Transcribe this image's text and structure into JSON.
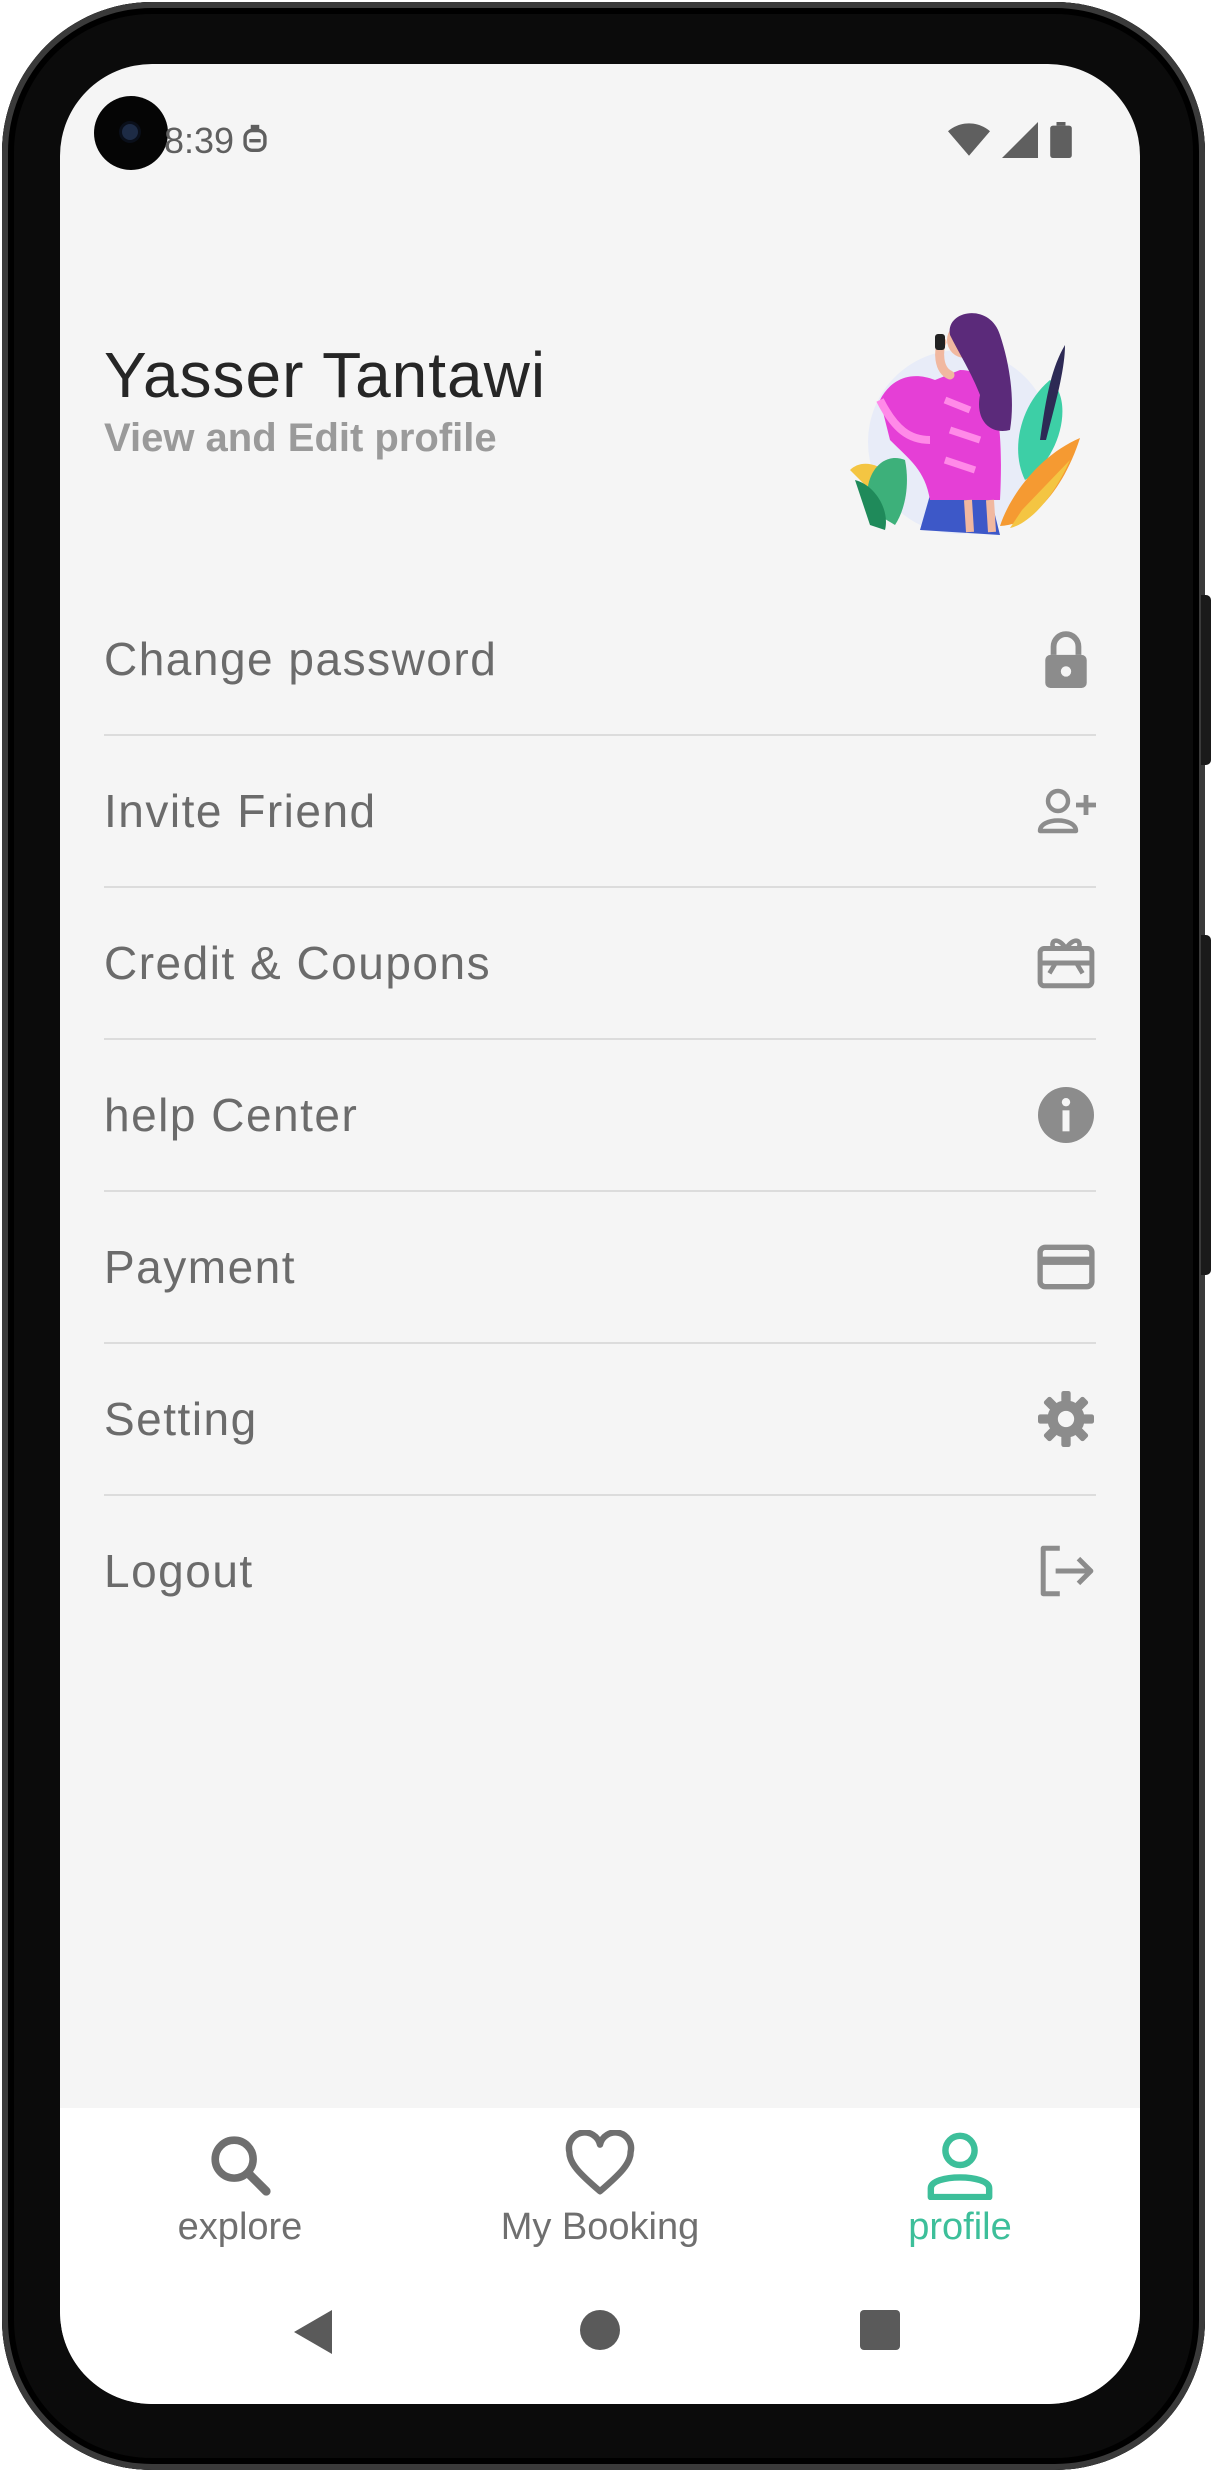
{
  "status_bar": {
    "time": "8:39",
    "icons": [
      "notification-icon",
      "wifi-icon",
      "signal-icon",
      "battery-icon"
    ]
  },
  "profile": {
    "name": "Yasser Tantawi",
    "subtitle": "View and Edit profile",
    "avatar_icon": "avatar-illustration"
  },
  "menu": {
    "items": [
      {
        "label": "Change password",
        "icon": "lock-icon"
      },
      {
        "label": "Invite Friend",
        "icon": "person-add-icon"
      },
      {
        "label": "Credit & Coupons",
        "icon": "gift-card-icon"
      },
      {
        "label": "help Center",
        "icon": "info-icon"
      },
      {
        "label": "Payment",
        "icon": "credit-card-icon"
      },
      {
        "label": "Setting",
        "icon": "gear-icon"
      },
      {
        "label": "Logout",
        "icon": "logout-icon"
      }
    ]
  },
  "bottom_nav": {
    "items": [
      {
        "label": "explore",
        "icon": "search-icon",
        "active": false
      },
      {
        "label": "My Booking",
        "icon": "heart-icon",
        "active": false
      },
      {
        "label": "profile",
        "icon": "person-icon",
        "active": true
      }
    ]
  },
  "colors": {
    "accent": "#3dbf9a",
    "background": "#f5f5f5",
    "text_primary": "#262626",
    "text_secondary": "#6b6b6b",
    "divider": "#dcdcdc"
  }
}
